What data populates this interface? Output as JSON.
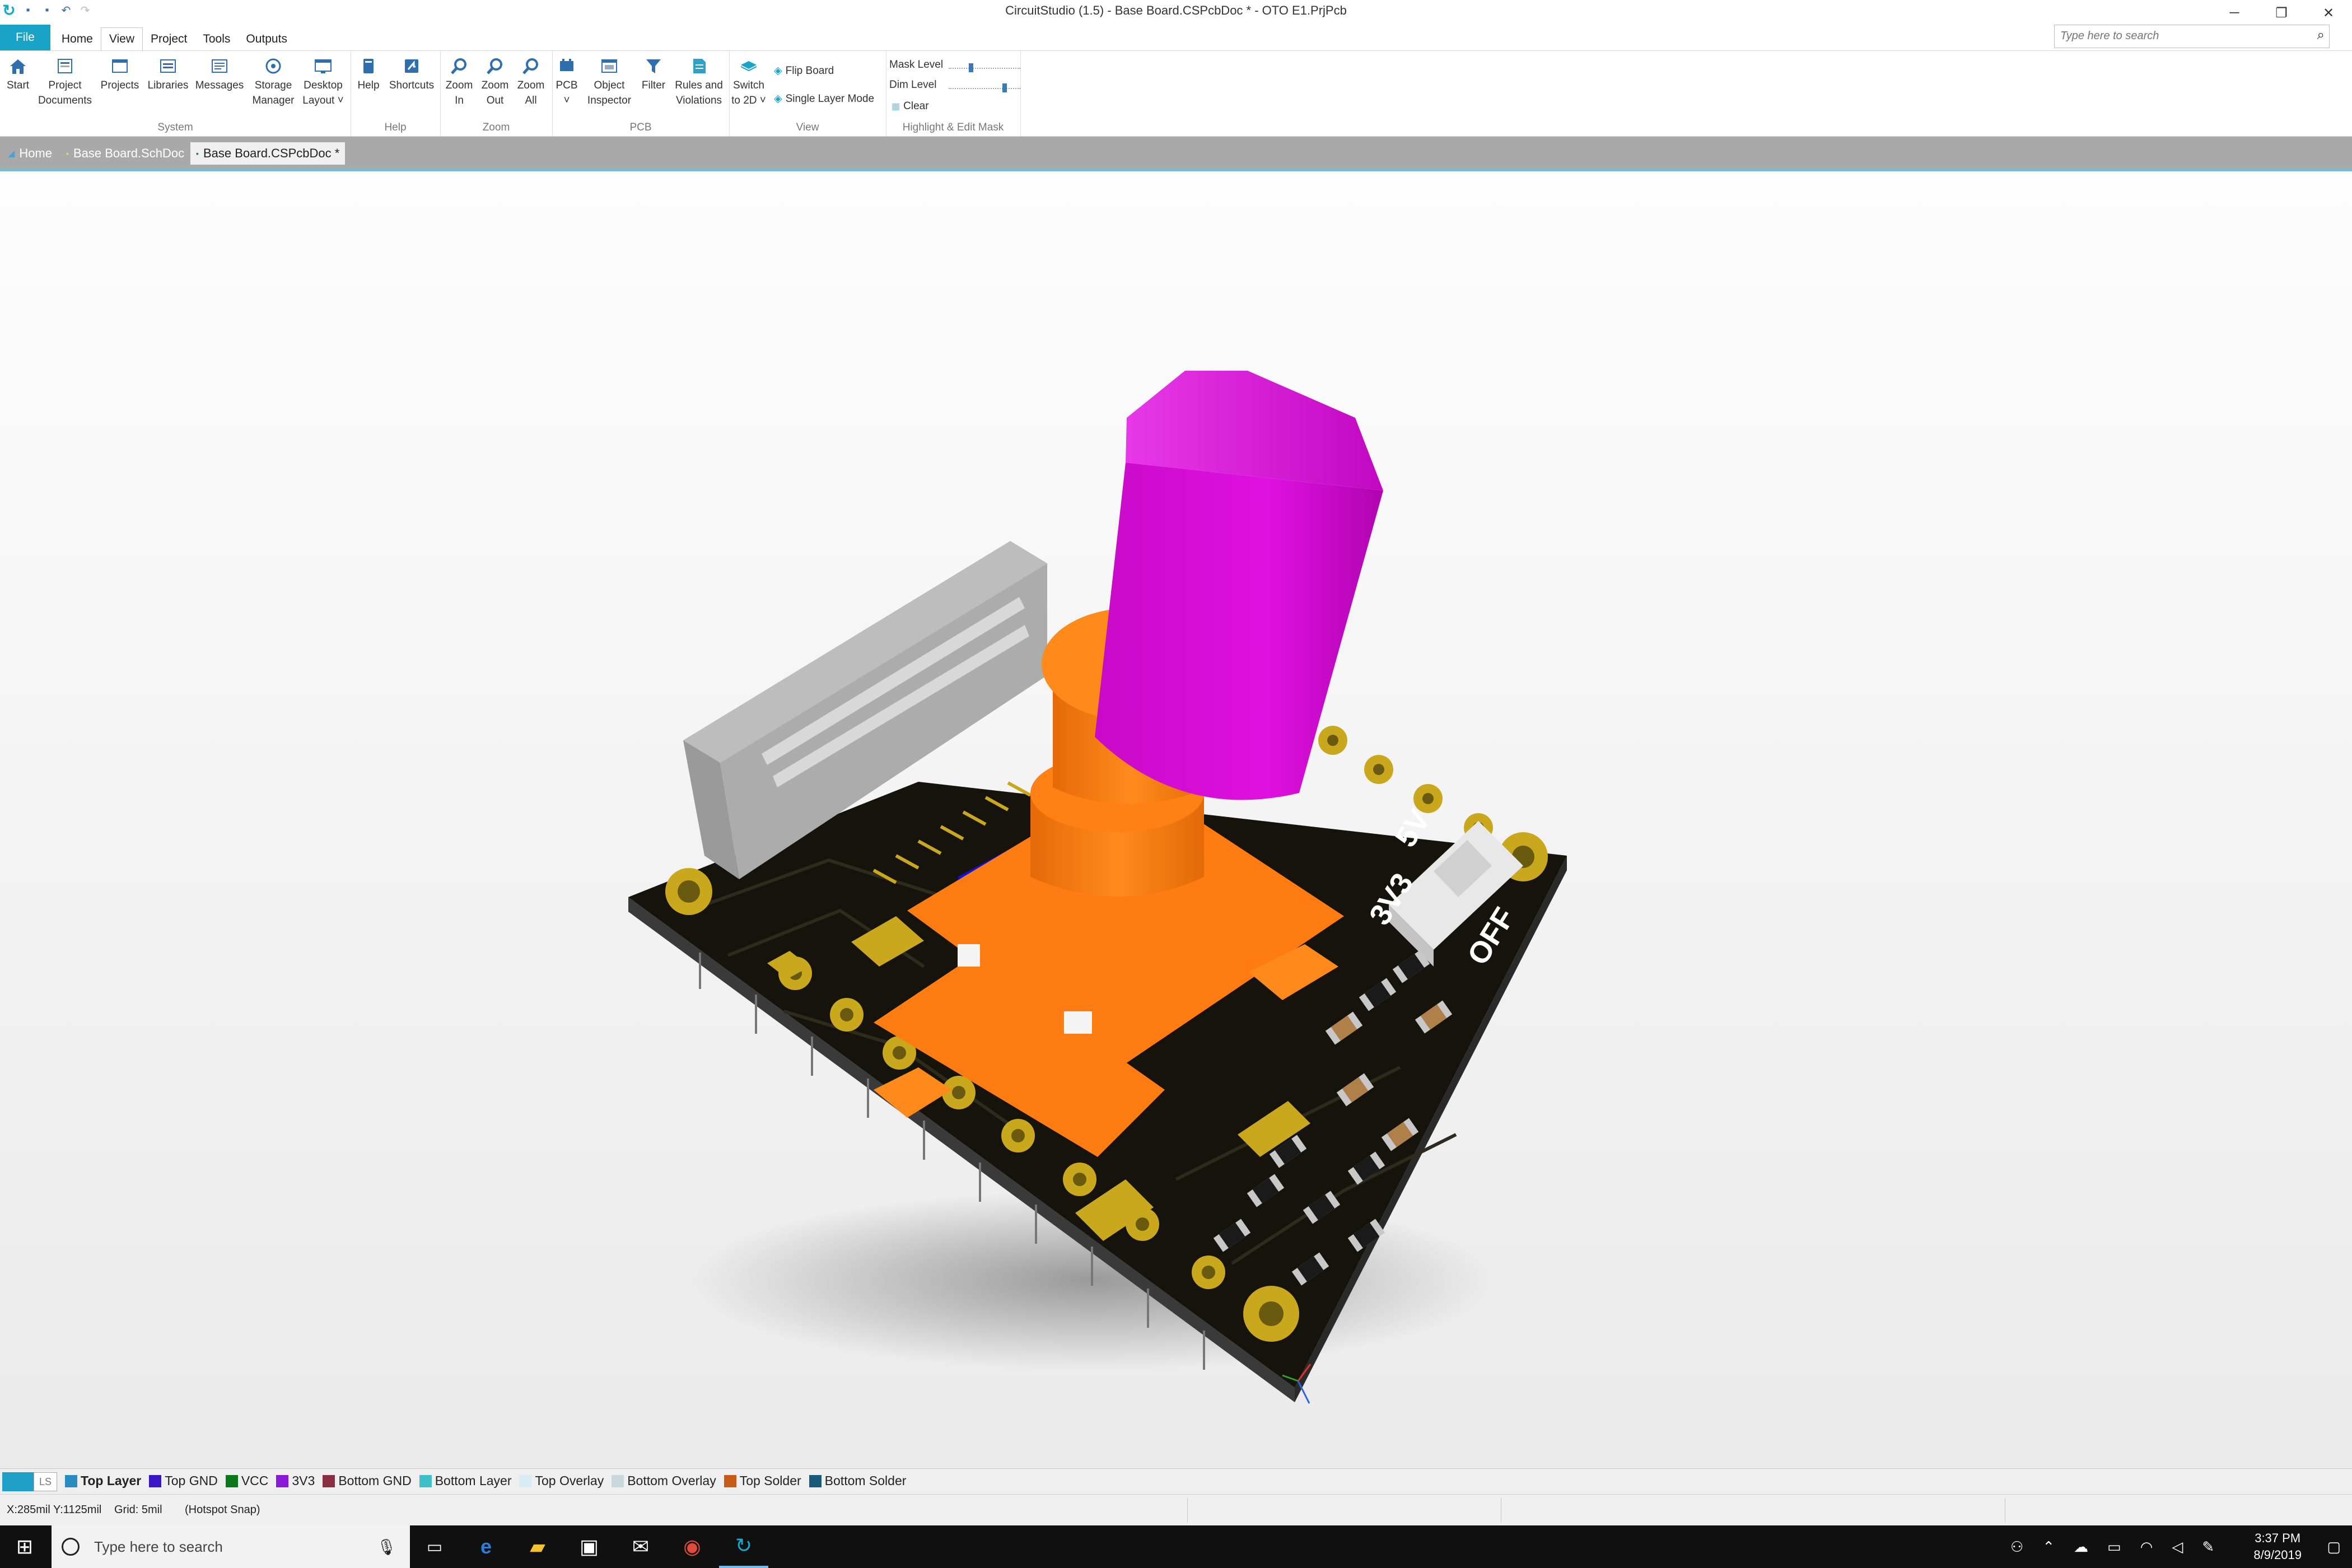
{
  "window": {
    "title": "CircuitStudio (1.5) - Base Board.CSPcbDoc * - OTO E1.PrjPcb",
    "controls": [
      "─",
      "❐",
      "✕"
    ]
  },
  "ribbon_tabs": [
    "File",
    "Home",
    "View",
    "Project",
    "Tools",
    "Outputs"
  ],
  "active_tab": "View",
  "search": {
    "placeholder": "Type here to search"
  },
  "groups": {
    "system": {
      "label": "System",
      "buttons": [
        {
          "label": "Start",
          "icon": "home-icon"
        },
        {
          "label": "Project\nDocuments",
          "icon": "project-documents-icon"
        },
        {
          "label": "Projects",
          "icon": "projects-icon"
        },
        {
          "label": "Libraries",
          "icon": "libraries-icon"
        },
        {
          "label": "Messages",
          "icon": "messages-icon"
        },
        {
          "label": "Storage\nManager",
          "icon": "storage-manager-icon"
        },
        {
          "label": "Desktop\nLayout ˅",
          "icon": "desktop-layout-icon"
        }
      ]
    },
    "help": {
      "label": "Help",
      "buttons": [
        {
          "label": "Help",
          "icon": "help-book-icon"
        },
        {
          "label": "Shortcuts",
          "icon": "shortcuts-icon"
        }
      ]
    },
    "zoom": {
      "label": "Zoom",
      "buttons": [
        {
          "label": "Zoom\nIn",
          "icon": "zoom-in-icon"
        },
        {
          "label": "Zoom\nOut",
          "icon": "zoom-out-icon"
        },
        {
          "label": "Zoom\nAll",
          "icon": "zoom-all-icon"
        }
      ]
    },
    "pcb": {
      "label": "PCB",
      "buttons": [
        {
          "label": "PCB\n˅",
          "icon": "pcb-icon"
        },
        {
          "label": "Object\nInspector",
          "icon": "object-inspector-icon"
        },
        {
          "label": "Filter",
          "icon": "filter-icon"
        },
        {
          "label": "Rules and\nViolations",
          "icon": "rules-icon"
        }
      ]
    },
    "view": {
      "label": "View",
      "switch_label": "Switch\nto 2D ˅",
      "flip_label": "Flip Board",
      "single_layer_label": "Single Layer Mode"
    },
    "mask": {
      "label": "Highlight & Edit Mask",
      "mask_level": "Mask Level",
      "mask_level_value": 0.3,
      "dim_level": "Dim Level",
      "dim_level_value": 0.8,
      "clear_label": "Clear"
    }
  },
  "doc_tabs": [
    {
      "label": "Home",
      "active": false
    },
    {
      "label": "Base Board.SchDoc",
      "active": false
    },
    {
      "label": "Base Board.CSPcbDoc *",
      "active": true
    }
  ],
  "silkscreen": {
    "label_3v3": "3V3",
    "label_5v": "5V",
    "label_off": "OFF"
  },
  "layers": {
    "ls_label": "LS",
    "items": [
      {
        "name": "Top Layer",
        "color": "#2a8bc0",
        "active": true
      },
      {
        "name": "Top GND",
        "color": "#3a14c8",
        "active": false
      },
      {
        "name": "VCC",
        "color": "#0a7a1a",
        "active": false
      },
      {
        "name": "3V3",
        "color": "#8a18d8",
        "active": false
      },
      {
        "name": "Bottom GND",
        "color": "#8a3040",
        "active": false
      },
      {
        "name": "Bottom Layer",
        "color": "#40c0c8",
        "active": false
      },
      {
        "name": "Top Overlay",
        "color": "#d8ecf4",
        "active": false
      },
      {
        "name": "Bottom Overlay",
        "color": "#c8d8dc",
        "active": false
      },
      {
        "name": "Top Solder",
        "color": "#c85a18",
        "active": false
      },
      {
        "name": "Bottom Solder",
        "color": "#1a5a78",
        "active": false
      }
    ]
  },
  "status": {
    "coords": "X:285mil Y:1125mil",
    "grid": "Grid: 5mil",
    "snap": "(Hotspot Snap)"
  },
  "taskbar": {
    "search_placeholder": "Type here to search",
    "time": "3:37 PM",
    "date": "8/9/2019"
  },
  "colors": {
    "accent": "#1aa3c9",
    "pcb_board": "#15130c",
    "pad_gold": "#c9a81e",
    "knob_magenta": "#d40ed4",
    "body_orange": "#ff7c12",
    "connector_gray": "#a2a2a2",
    "switch_blue": "#1010e0"
  }
}
